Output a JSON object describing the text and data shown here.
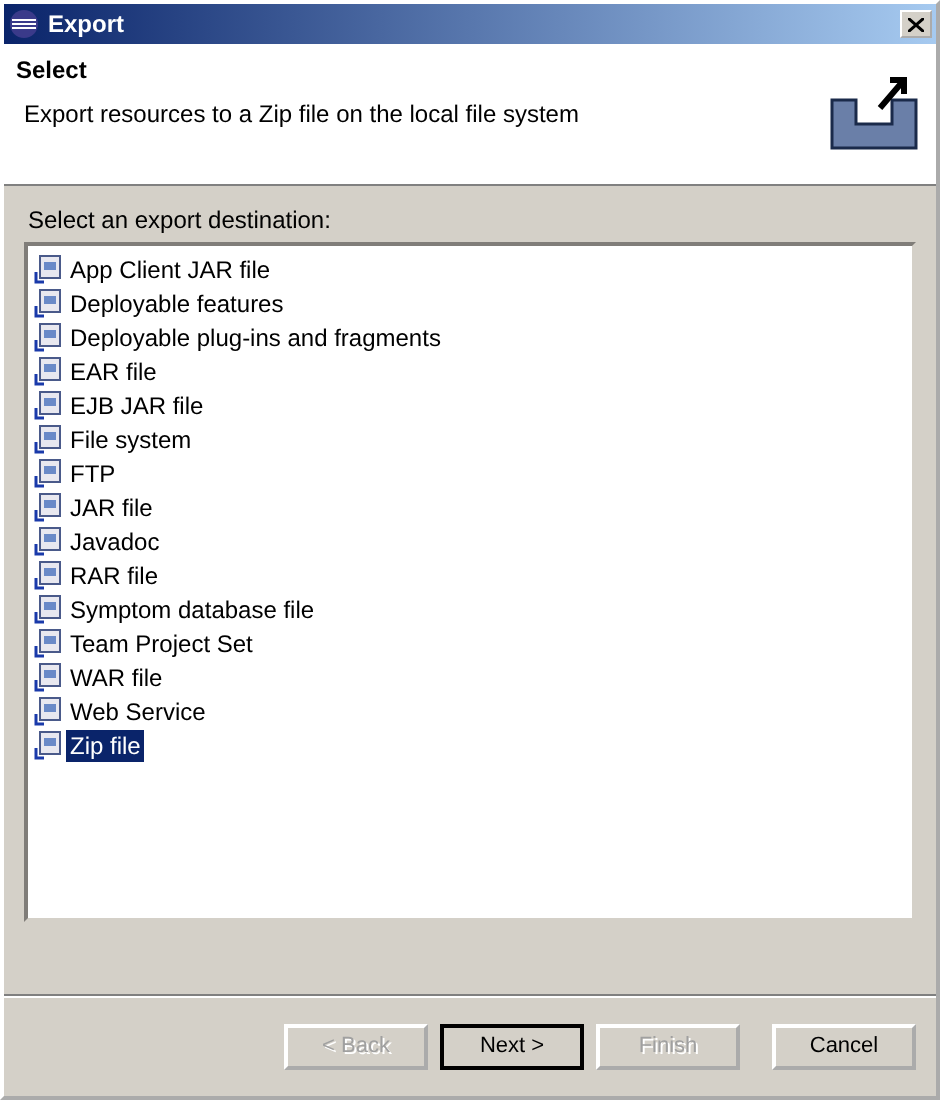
{
  "window": {
    "title": "Export"
  },
  "header": {
    "title": "Select",
    "description": "Export resources to a Zip file on the local file system"
  },
  "list": {
    "label": "Select an export destination:",
    "items": [
      {
        "label": "App Client JAR file",
        "selected": false
      },
      {
        "label": "Deployable features",
        "selected": false
      },
      {
        "label": "Deployable plug-ins and fragments",
        "selected": false
      },
      {
        "label": "EAR file",
        "selected": false
      },
      {
        "label": "EJB JAR file",
        "selected": false
      },
      {
        "label": "File system",
        "selected": false
      },
      {
        "label": "FTP",
        "selected": false
      },
      {
        "label": "JAR file",
        "selected": false
      },
      {
        "label": "Javadoc",
        "selected": false
      },
      {
        "label": "RAR file",
        "selected": false
      },
      {
        "label": "Symptom database file",
        "selected": false
      },
      {
        "label": "Team Project Set",
        "selected": false
      },
      {
        "label": "WAR file",
        "selected": false
      },
      {
        "label": "Web Service",
        "selected": false
      },
      {
        "label": "Zip file",
        "selected": true
      }
    ]
  },
  "buttons": [
    {
      "label": "< Back",
      "disabled": true,
      "default": false
    },
    {
      "label": "Next >",
      "disabled": false,
      "default": true
    },
    {
      "label": "Finish",
      "disabled": true,
      "default": false
    },
    {
      "label": "Cancel",
      "disabled": false,
      "default": false
    }
  ]
}
